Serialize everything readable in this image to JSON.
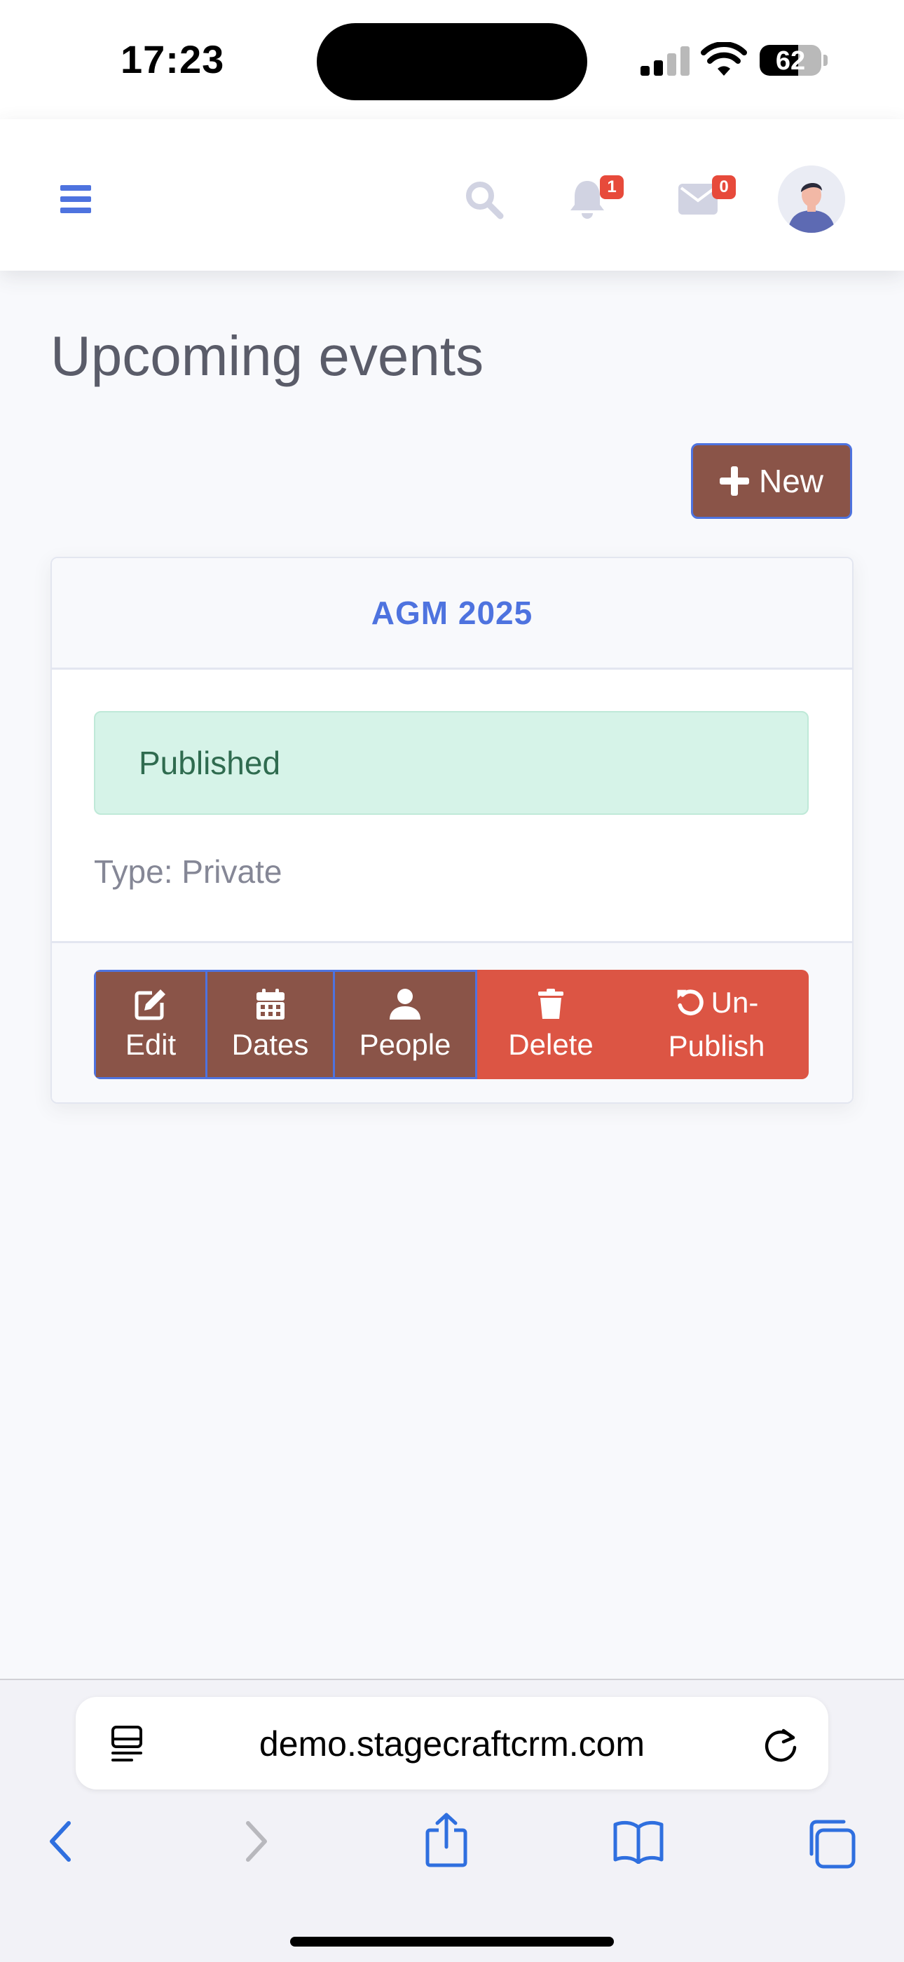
{
  "status_bar": {
    "time": "17:23",
    "battery": "62",
    "battery_level": 0.62
  },
  "topbar": {
    "notifications_count": "1",
    "messages_count": "0"
  },
  "page": {
    "title": "Upcoming events",
    "new_button": "New"
  },
  "event_card": {
    "title": "AGM 2025",
    "status": "Published",
    "type_line": "Type: Private",
    "actions": [
      {
        "label": "Edit",
        "icon": "edit-icon"
      },
      {
        "label": "Dates",
        "icon": "calendar-icon"
      },
      {
        "label": "People",
        "icon": "user-icon"
      },
      {
        "label": "Delete",
        "icon": "trash-icon"
      },
      {
        "label_line1": "Un-",
        "label_line2": "Publish",
        "icon": "undo-icon"
      }
    ]
  },
  "browser": {
    "url": "demo.stagecraftcrm.com"
  },
  "colors": {
    "primary": "#4e73df",
    "brown": "#8a5448",
    "danger": "#dc5544",
    "success_bg": "#d6f3e8",
    "ios_blue": "#2f6fdf"
  }
}
